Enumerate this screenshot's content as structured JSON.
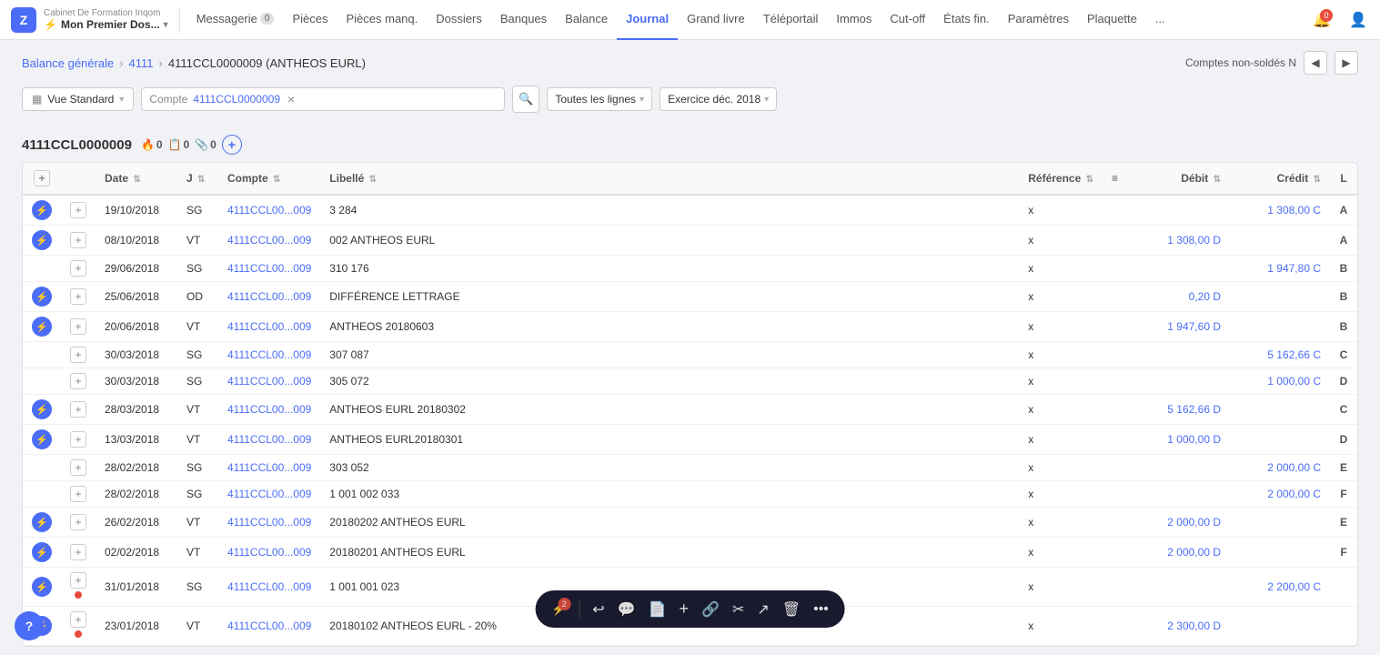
{
  "company": {
    "header": "Cabinet De Formation Inqom",
    "dossier_label": "Mon Premier Dos...",
    "lightning": "⚡"
  },
  "nav": {
    "items": [
      {
        "id": "messagerie",
        "label": "Messagerie",
        "badge": "0",
        "active": false
      },
      {
        "id": "pieces",
        "label": "Pièces",
        "active": false
      },
      {
        "id": "pieces-manq",
        "label": "Pièces manq.",
        "active": false
      },
      {
        "id": "dossiers",
        "label": "Dossiers",
        "active": false
      },
      {
        "id": "banques",
        "label": "Banques",
        "active": false
      },
      {
        "id": "balance",
        "label": "Balance",
        "active": false
      },
      {
        "id": "journal",
        "label": "Journal",
        "active": true
      },
      {
        "id": "grand-livre",
        "label": "Grand livre",
        "active": false
      },
      {
        "id": "teleportail",
        "label": "Téléportail",
        "active": false
      },
      {
        "id": "immos",
        "label": "Immos",
        "active": false
      },
      {
        "id": "cut-off",
        "label": "Cut-off",
        "active": false
      },
      {
        "id": "etats-fin",
        "label": "États fin.",
        "active": false
      },
      {
        "id": "parametres",
        "label": "Paramètres",
        "active": false
      },
      {
        "id": "plaquette",
        "label": "Plaquette",
        "active": false
      },
      {
        "id": "more",
        "label": "...",
        "active": false
      }
    ],
    "notif_count": "0",
    "user_icon": "👤"
  },
  "breadcrumb": {
    "items": [
      {
        "label": "Balance générale",
        "link": true
      },
      {
        "label": "4111",
        "link": true
      },
      {
        "label": "4111CCL0000009 (ANTHEOS EURL)",
        "link": false
      }
    ],
    "non_soldes_label": "Comptes non-soldés N",
    "prev_icon": "◀",
    "next_icon": "▶"
  },
  "toolbar": {
    "vue_standard": "Vue Standard",
    "compte_label": "Compte",
    "compte_value": "4111CCL0000009",
    "lines_option": "Toutes les lignes",
    "exercice_option": "Exercice déc. 2018"
  },
  "account": {
    "id": "4111CCL0000009",
    "fire_count": "0",
    "doc_count": "0",
    "clip_count": "0"
  },
  "table": {
    "columns": [
      {
        "id": "actions",
        "label": "",
        "sortable": false
      },
      {
        "id": "plus",
        "label": "+",
        "sortable": false
      },
      {
        "id": "date",
        "label": "Date",
        "sortable": true
      },
      {
        "id": "j",
        "label": "J",
        "sortable": true
      },
      {
        "id": "compte",
        "label": "Compte",
        "sortable": true
      },
      {
        "id": "libelle",
        "label": "Libellé",
        "sortable": true
      },
      {
        "id": "reference",
        "label": "Référence",
        "sortable": true
      },
      {
        "id": "filter",
        "label": "≡",
        "sortable": false
      },
      {
        "id": "debit",
        "label": "Débit",
        "sortable": true
      },
      {
        "id": "credit",
        "label": "Crédit",
        "sortable": true
      },
      {
        "id": "l",
        "label": "L",
        "sortable": false
      }
    ],
    "rows": [
      {
        "has_lightning": true,
        "has_plus": true,
        "has_dot": false,
        "date": "19/10/2018",
        "j": "SG",
        "compte": "4111CCL00...009",
        "libelle": "3 284",
        "ref": "x",
        "debit": "",
        "credit": "1 308,00 C",
        "l": "A"
      },
      {
        "has_lightning": true,
        "has_plus": true,
        "has_dot": false,
        "date": "08/10/2018",
        "j": "VT",
        "compte": "4111CCL00...009",
        "libelle": "002 ANTHEOS EURL",
        "ref": "x",
        "debit": "1 308,00 D",
        "credit": "",
        "l": "A"
      },
      {
        "has_lightning": false,
        "has_plus": true,
        "has_dot": false,
        "date": "29/06/2018",
        "j": "SG",
        "compte": "4111CCL00...009",
        "libelle": "310 176",
        "ref": "x",
        "debit": "",
        "credit": "1 947,80 C",
        "l": "B"
      },
      {
        "has_lightning": true,
        "has_plus": true,
        "has_dot": false,
        "date": "25/06/2018",
        "j": "OD",
        "compte": "4111CCL00...009",
        "libelle": "DIFFÉRENCE LETTRAGE",
        "ref": "x",
        "debit": "0,20 D",
        "credit": "",
        "l": "B"
      },
      {
        "has_lightning": true,
        "has_plus": true,
        "has_dot": false,
        "date": "20/06/2018",
        "j": "VT",
        "compte": "4111CCL00...009",
        "libelle": "ANTHEOS 20180603",
        "ref": "x",
        "debit": "1 947,60 D",
        "credit": "",
        "l": "B"
      },
      {
        "has_lightning": false,
        "has_plus": true,
        "has_dot": false,
        "date": "30/03/2018",
        "j": "SG",
        "compte": "4111CCL00...009",
        "libelle": "307 087",
        "ref": "x",
        "debit": "",
        "credit": "5 162,66 C",
        "l": "C"
      },
      {
        "has_lightning": false,
        "has_plus": true,
        "has_dot": false,
        "date": "30/03/2018",
        "j": "SG",
        "compte": "4111CCL00...009",
        "libelle": "305 072",
        "ref": "x",
        "debit": "",
        "credit": "1 000,00 C",
        "l": "D"
      },
      {
        "has_lightning": true,
        "has_plus": true,
        "has_dot": false,
        "date": "28/03/2018",
        "j": "VT",
        "compte": "4111CCL00...009",
        "libelle": "ANTHEOS EURL 20180302",
        "ref": "x",
        "debit": "5 162,66 D",
        "credit": "",
        "l": "C"
      },
      {
        "has_lightning": true,
        "has_plus": true,
        "has_dot": false,
        "date": "13/03/2018",
        "j": "VT",
        "compte": "4111CCL00...009",
        "libelle": "ANTHEOS EURL20180301",
        "ref": "x",
        "debit": "1 000,00 D",
        "credit": "",
        "l": "D"
      },
      {
        "has_lightning": false,
        "has_plus": true,
        "has_dot": false,
        "date": "28/02/2018",
        "j": "SG",
        "compte": "4111CCL00...009",
        "libelle": "303 052",
        "ref": "x",
        "debit": "",
        "credit": "2 000,00 C",
        "l": "E"
      },
      {
        "has_lightning": false,
        "has_plus": true,
        "has_dot": false,
        "date": "28/02/2018",
        "j": "SG",
        "compte": "4111CCL00...009",
        "libelle": "1 001 002 033",
        "ref": "x",
        "debit": "",
        "credit": "2 000,00 C",
        "l": "F"
      },
      {
        "has_lightning": true,
        "has_plus": true,
        "has_dot": false,
        "date": "26/02/2018",
        "j": "VT",
        "compte": "4111CCL00...009",
        "libelle": "20180202 ANTHEOS EURL",
        "ref": "x",
        "debit": "2 000,00 D",
        "credit": "",
        "l": "E"
      },
      {
        "has_lightning": true,
        "has_plus": true,
        "has_dot": false,
        "date": "02/02/2018",
        "j": "VT",
        "compte": "4111CCL00...009",
        "libelle": "20180201 ANTHEOS EURL",
        "ref": "x",
        "debit": "2 000,00 D",
        "credit": "",
        "l": "F"
      },
      {
        "has_lightning": true,
        "has_plus": true,
        "has_dot": true,
        "date": "31/01/2018",
        "j": "SG",
        "compte": "4111CCL00...009",
        "libelle": "1 001 001 023",
        "ref": "x",
        "debit": "",
        "credit": "2 200,00 C",
        "l": ""
      },
      {
        "has_lightning": true,
        "has_plus": true,
        "has_dot": true,
        "date": "23/01/2018",
        "j": "VT",
        "compte": "4111CCL00...009",
        "libelle": "20180102 ANTHEOS EURL - 20%",
        "ref": "x",
        "debit": "2 300,00 D",
        "credit": "",
        "l": ""
      }
    ]
  },
  "bottom_toolbar": {
    "badge_count": "2",
    "icons": [
      "↩",
      "💬",
      "📄",
      "+",
      "🔗",
      "✂",
      "↗",
      "🗑",
      "•••"
    ]
  },
  "help": {
    "label": "?"
  }
}
